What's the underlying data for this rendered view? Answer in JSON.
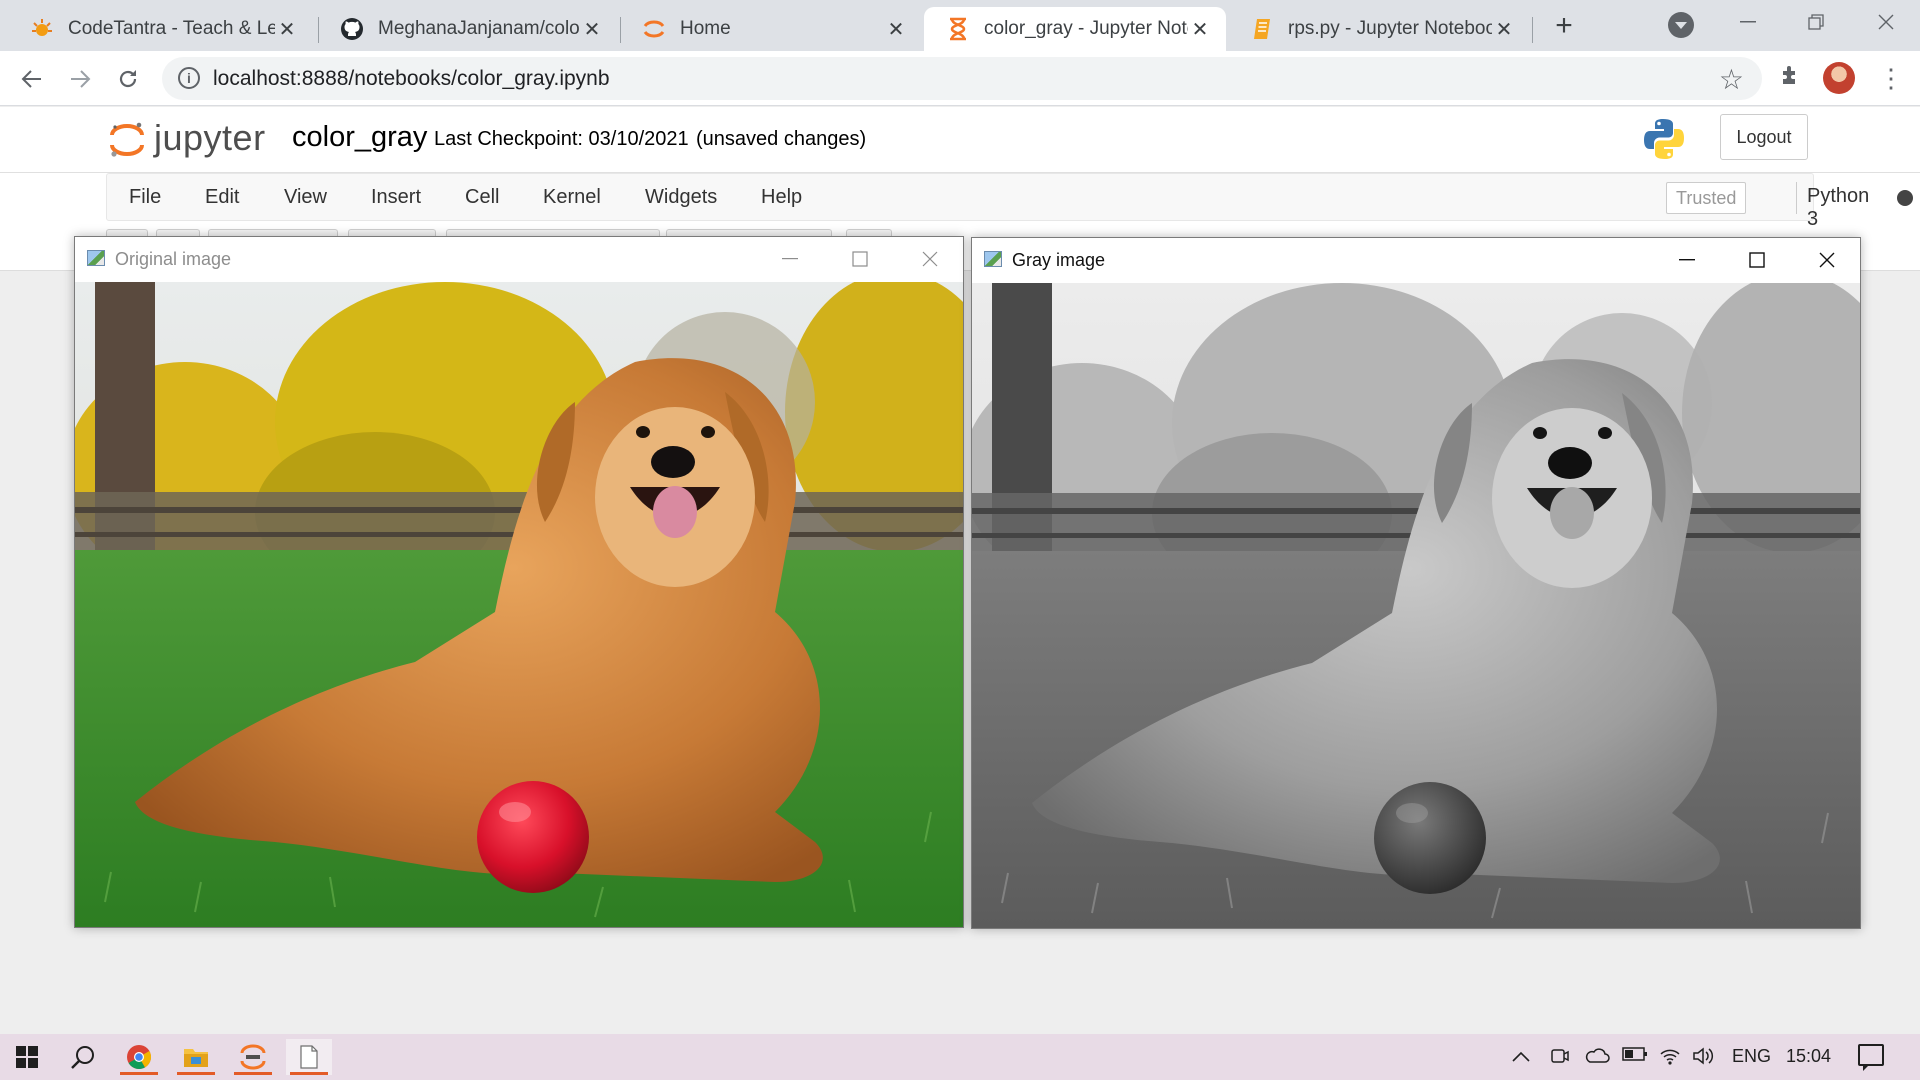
{
  "browser": {
    "tabs": [
      {
        "title": "CodeTantra - Teach & Lear",
        "icon": "codetantra-favicon",
        "active": false
      },
      {
        "title": "MeghanaJanjanam/colour",
        "icon": "github-favicon",
        "active": false
      },
      {
        "title": "Home",
        "icon": "jupyter-favicon",
        "active": false
      },
      {
        "title": "color_gray - Jupyter Note",
        "icon": "hourglass-favicon",
        "active": true
      },
      {
        "title": "rps.py - Jupyter Notebook",
        "icon": "notebook-favicon",
        "active": false
      }
    ],
    "new_tab_glyph": "+",
    "close_glyph": "✕",
    "url": "localhost:8888/notebooks/color_gray.ipynb"
  },
  "jupyter": {
    "logo_text": "jupyter",
    "notebook_name": "color_gray",
    "checkpoint": "Last Checkpoint: 03/10/2021",
    "save_status": "(unsaved changes)",
    "logout_label": "Logout",
    "menu": [
      "File",
      "Edit",
      "View",
      "Insert",
      "Cell",
      "Kernel",
      "Widgets",
      "Help"
    ],
    "trusted_label": "Trusted",
    "kernel_name": "Python 3"
  },
  "windows": {
    "original": {
      "title": "Original image",
      "state": "inactive"
    },
    "gray": {
      "title": "Gray image",
      "state": "active"
    }
  },
  "taskbar": {
    "language": "ENG",
    "time": "15:04"
  },
  "colors": {
    "jupyter_orange": "#f37626",
    "tab_strip": "#dee1e6",
    "taskbar": "#e8dbe6",
    "ball_red": "#d8102a"
  }
}
